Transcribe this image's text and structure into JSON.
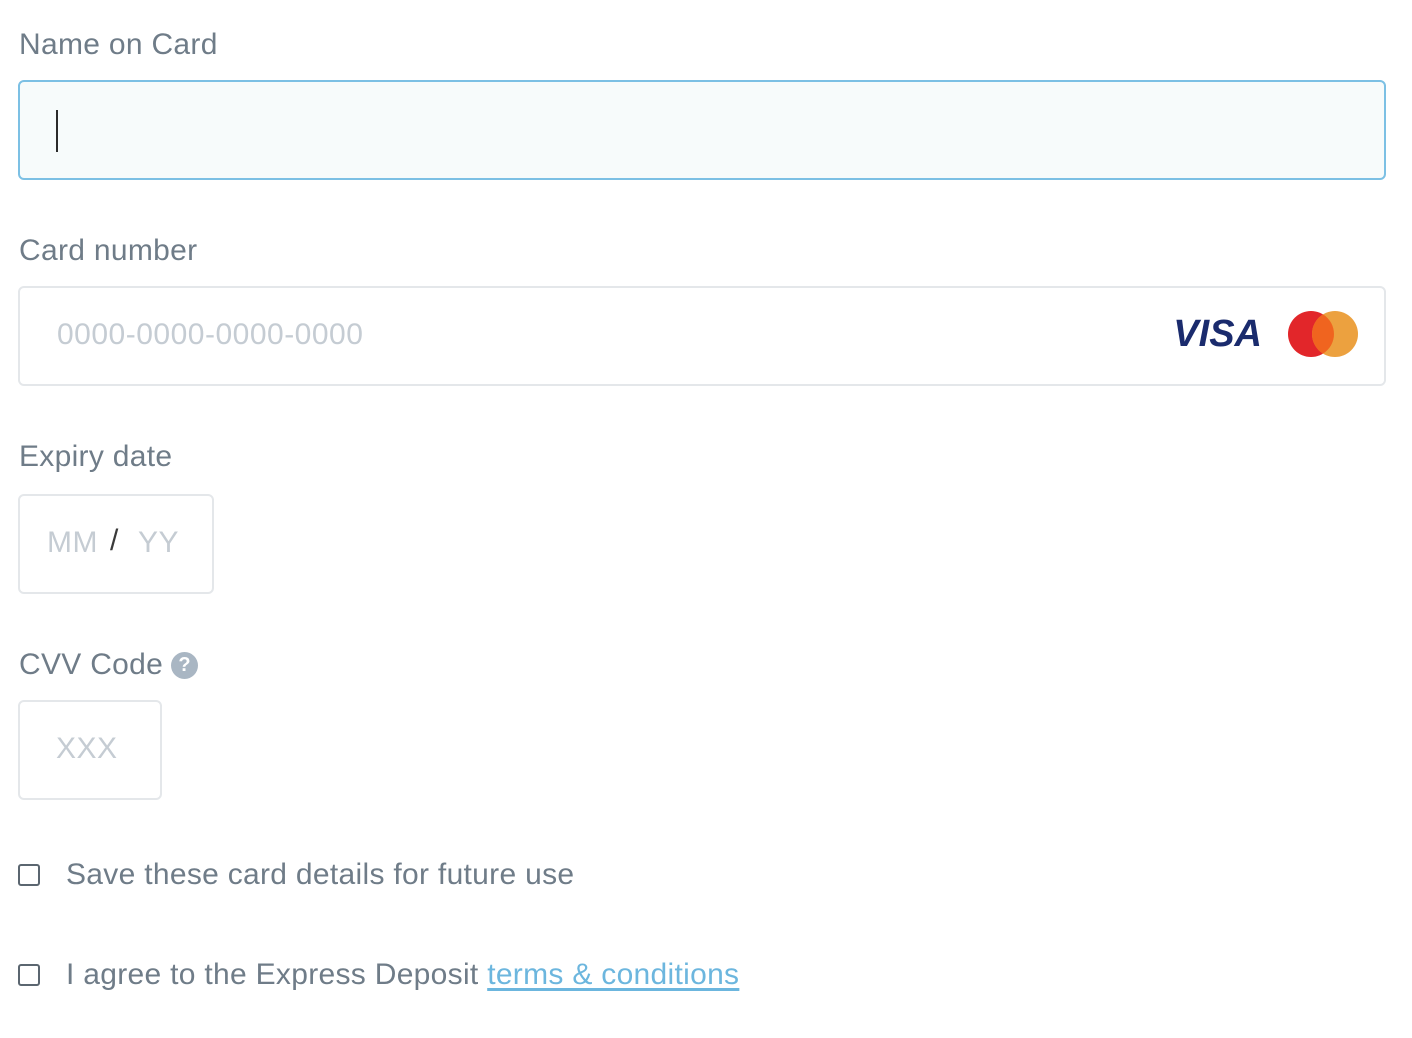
{
  "name_on_card": {
    "label": "Name on Card",
    "value": ""
  },
  "card_number": {
    "label": "Card number",
    "placeholder": "0000-0000-0000-0000",
    "value": "",
    "brands": [
      "VISA",
      "mastercard-logo"
    ],
    "visa_label": "VISA"
  },
  "expiry": {
    "label": "Expiry date",
    "month_placeholder": "MM",
    "separator": "/",
    "year_placeholder": "YY"
  },
  "cvv": {
    "label": "CVV Code",
    "help_icon": "question-icon",
    "help_glyph": "?",
    "placeholder": "XXX"
  },
  "save_card": {
    "label": "Save these card details for future use",
    "checked": false
  },
  "agree_terms": {
    "label": "I agree to the Express Deposit ",
    "link_text": "terms & conditions",
    "checked": false
  },
  "colors": {
    "focus_border": "#7cc0e4",
    "link": "#6cb6de",
    "visa": "#1a2b6d",
    "mastercard_red": "#e2262a",
    "mastercard_orange": "#eb9c35"
  }
}
